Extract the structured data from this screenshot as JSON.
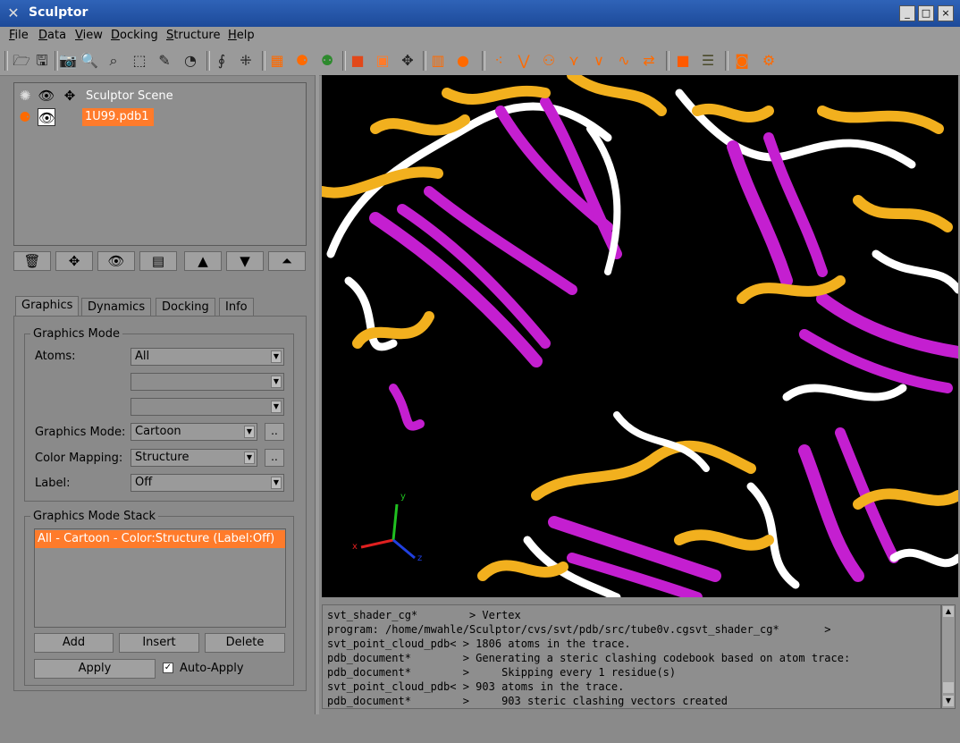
{
  "window": {
    "title": "Sculptor",
    "app_icon": "x-logo-icon",
    "controls": {
      "minimize": "_",
      "maximize": "□",
      "close": "×"
    }
  },
  "menubar": {
    "items": [
      {
        "label": "File",
        "mnemonic": "F"
      },
      {
        "label": "Data",
        "mnemonic": "D"
      },
      {
        "label": "View",
        "mnemonic": "V"
      },
      {
        "label": "Docking",
        "mnemonic": "D"
      },
      {
        "label": "Structure",
        "mnemonic": "S"
      },
      {
        "label": "Help",
        "mnemonic": "H"
      }
    ]
  },
  "toolbar": {
    "icons": [
      "open-icon",
      "save-icon",
      "camera-icon",
      "zoom-in-icon",
      "zoom-fit-icon",
      "box-icon",
      "pen-icon",
      "clock-icon",
      "helix-icon",
      "grid-icon",
      "atoms-grid-icon",
      "molecule-icon",
      "molecule-green-icon",
      "cube-red-icon",
      "cube-orange-icon",
      "move-icon",
      "piano-icon",
      "sphere-icon",
      "points-icon",
      "vchain-icon",
      "beads-icon",
      "tree-icon",
      "vbar-icon",
      "wave-icon",
      "swap-icon",
      "square-orange-icon",
      "stack-icon",
      "target-icon",
      "gear-icon"
    ]
  },
  "scene_tree": {
    "root": {
      "label": "Sculptor Scene"
    },
    "nodes": [
      {
        "label": "1U99.pdb1"
      }
    ],
    "buttons": [
      "trash-icon",
      "move-icon",
      "eye-icon",
      "document-icon",
      "triangle-up-icon",
      "triangle-down-icon",
      "triangle-top-icon"
    ]
  },
  "tabs": [
    {
      "label": "Graphics",
      "active": true
    },
    {
      "label": "Dynamics",
      "active": false
    },
    {
      "label": "Docking",
      "active": false
    },
    {
      "label": "Info",
      "active": false
    }
  ],
  "graphics_mode": {
    "title": "Graphics Mode",
    "atoms_label": "Atoms:",
    "atoms_value": "All",
    "extra_combo_1": "",
    "extra_combo_2": "",
    "mode_label": "Graphics Mode:",
    "mode_value": "Cartoon",
    "color_label": "Color Mapping:",
    "color_value": "Structure",
    "label_label": "Label:",
    "label_value": "Off",
    "dots": ".."
  },
  "stack": {
    "title": "Graphics Mode Stack",
    "items": [
      "All - Cartoon - Color:Structure (Label:Off)"
    ],
    "add": "Add",
    "insert": "Insert",
    "delete": "Delete",
    "apply": "Apply",
    "auto_apply": "Auto-Apply",
    "auto_apply_checked": true
  },
  "viewport": {
    "axes": {
      "x": "x",
      "y": "y",
      "z": "z"
    },
    "colors": {
      "helix": "#f2b01e",
      "sheet": "#c41fd0",
      "coil": "#ffffff",
      "background": "#000000"
    }
  },
  "console": {
    "lines": [
      "svt_shader_cg*        > Vertex",
      "program: /home/mwahle/Sculptor/cvs/svt/pdb/src/tube0v.cgsvt_shader_cg*       >",
      "svt_point_cloud_pdb< > 1806 atoms in the trace.",
      "pdb_document*        > Generating a steric clashing codebook based on atom trace:",
      "pdb_document*        >     Skipping every 1 residue(s)",
      "svt_point_cloud_pdb< > 903 atoms in the trace.",
      "pdb_document*        >     903 steric clashing vectors created"
    ]
  }
}
